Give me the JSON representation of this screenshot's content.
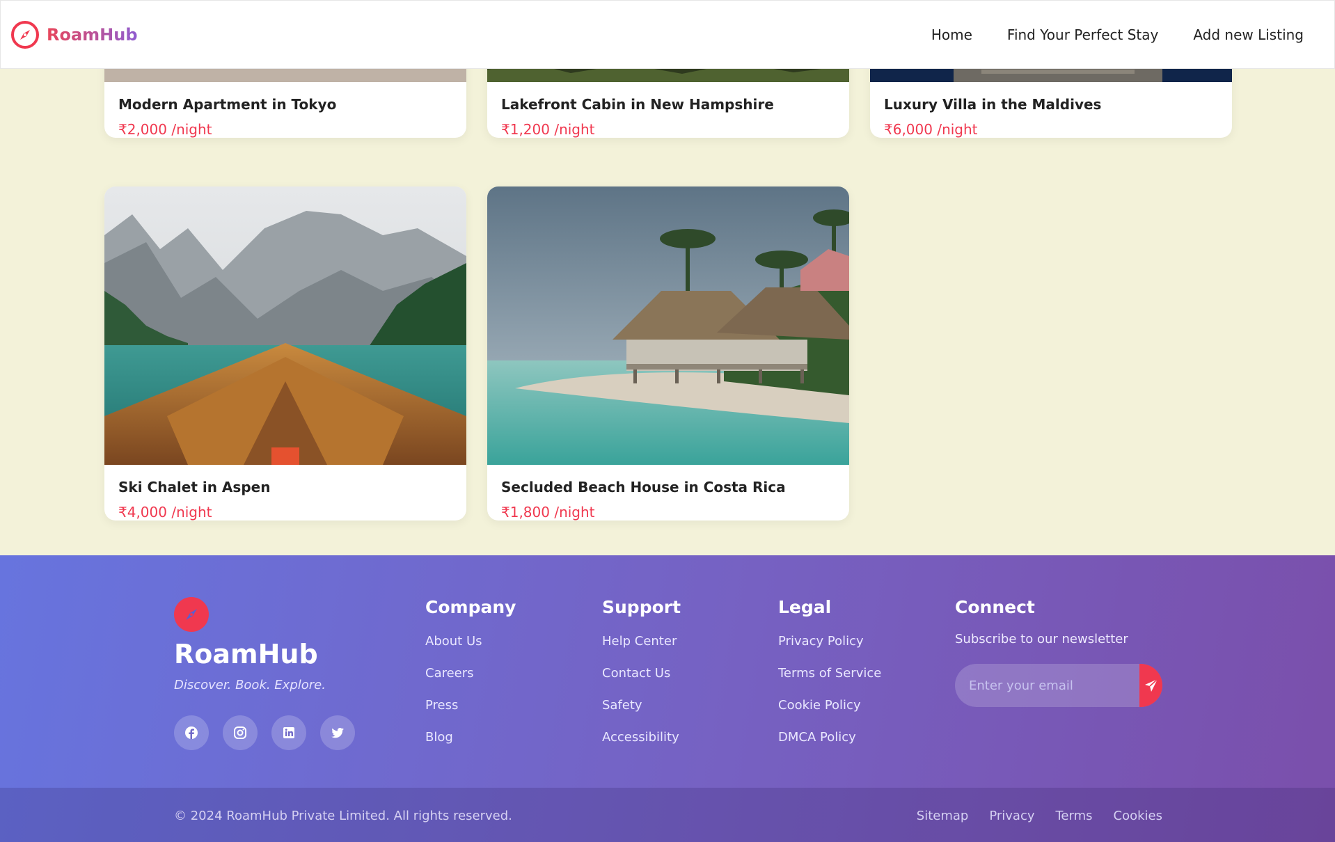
{
  "nav": {
    "brand": "RoamHub",
    "links": [
      "Home",
      "Find Your Perfect Stay",
      "Add new Listing"
    ]
  },
  "listings": [
    {
      "title": "Modern Apartment in Tokyo",
      "price": "₹2,000 /night"
    },
    {
      "title": "Lakefront Cabin in New Hampshire",
      "price": "₹1,200 /night"
    },
    {
      "title": "Luxury Villa in the Maldives",
      "price": "₹6,000 /night"
    },
    {
      "title": "Ski Chalet in Aspen",
      "price": "₹4,000 /night"
    },
    {
      "title": "Secluded Beach House in Costa Rica",
      "price": "₹1,800 /night"
    }
  ],
  "footer": {
    "brand": "RoamHub",
    "tagline": "Discover. Book. Explore.",
    "socials": [
      "facebook-icon",
      "instagram-icon",
      "linkedin-icon",
      "twitter-icon"
    ],
    "columns": [
      {
        "title": "Company",
        "items": [
          "About Us",
          "Careers",
          "Press",
          "Blog"
        ]
      },
      {
        "title": "Support",
        "items": [
          "Help Center",
          "Contact Us",
          "Safety",
          "Accessibility"
        ]
      },
      {
        "title": "Legal",
        "items": [
          "Privacy Policy",
          "Terms of Service",
          "Cookie Policy",
          "DMCA Policy"
        ]
      }
    ],
    "connect": {
      "title": "Connect",
      "subtitle": "Subscribe to our newsletter",
      "placeholder": "Enter your email"
    },
    "copyright": "© 2024 RoamHub Private Limited. All rights reserved.",
    "bottom_links": [
      "Sitemap",
      "Privacy",
      "Terms",
      "Cookies"
    ]
  },
  "colors": {
    "accent": "#f0384f",
    "page_bg": "#f3f2d9",
    "footer_gradient_start": "#6774de",
    "footer_gradient_end": "#7a4fab"
  }
}
